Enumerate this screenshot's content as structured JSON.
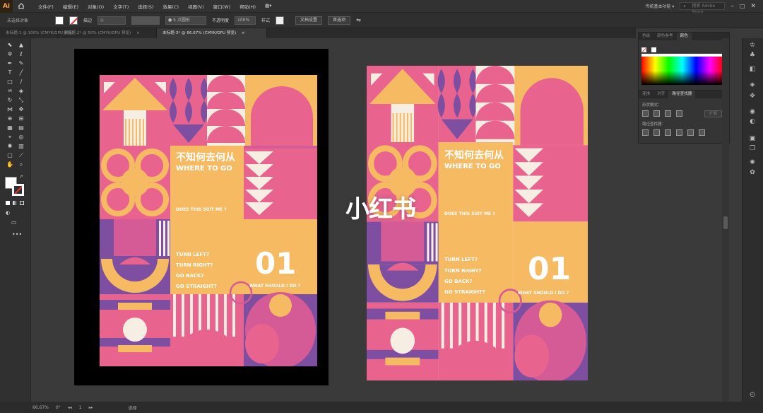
{
  "app": {
    "logo": "Ai",
    "home_icon": "home-icon"
  },
  "menu": [
    "文件(F)",
    "编辑(E)",
    "对象(O)",
    "文字(T)",
    "选择(S)",
    "效果(C)",
    "视图(V)",
    "窗口(W)",
    "帮助(H)"
  ],
  "menu_extra": "▦▾",
  "workspace": "传统基本功能 ▾",
  "search_placeholder": "搜索 Adobe Stock",
  "control": {
    "selection": "未选择对象",
    "stroke_label": "描边",
    "stroke_value": "◇",
    "brush": "● 5 点圆形",
    "opacity_label": "不透明度",
    "opacity_value": "100%",
    "style_label": "样式",
    "doc_setup": "文档设置",
    "prefs": "首选项"
  },
  "tabs": [
    {
      "label": "未标题-1 @ 100% (CMYK/GPU 预览)",
      "close": "×",
      "active": false
    },
    {
      "label": "未标题-2* @ 50% (CMYK/GPU 预览)",
      "close": "×",
      "active": false
    },
    {
      "label": "未标题-3* @ 66.67% (CMYK/GPU 预览)",
      "close": "×",
      "active": true
    }
  ],
  "panel_color": {
    "tabs": [
      "色板",
      "颜色参考",
      "颜色"
    ],
    "active": 2
  },
  "panel_pathfinder": {
    "tabs": [
      "变换",
      "对齐",
      "路径查找器"
    ],
    "active": 2,
    "shape_modes": "形状模式：",
    "pathfinders": "路径查找器：",
    "expand": "扩展"
  },
  "status": {
    "zoom": "66.67%",
    "angle": "0°",
    "artboard": "1",
    "tool": "选择"
  },
  "poster": {
    "title_cn": "不知何去何从",
    "title_en": "WHERE TO GO",
    "question": "DOES THIS SUIT ME ?",
    "opt1": "TURN LEFT?",
    "opt2": "TURN RIGHT?",
    "opt3": "GO BACK?",
    "opt4": "GO STRAIGHT?",
    "number": "01",
    "what": "WHAT SHOULD I DO ?"
  },
  "watermark": "小红书",
  "colors": {
    "pink": "#E8648E",
    "orange": "#F6BA62",
    "purple": "#7E4FA0",
    "magenta": "#D45B96",
    "cream": "#F7EEE3"
  }
}
